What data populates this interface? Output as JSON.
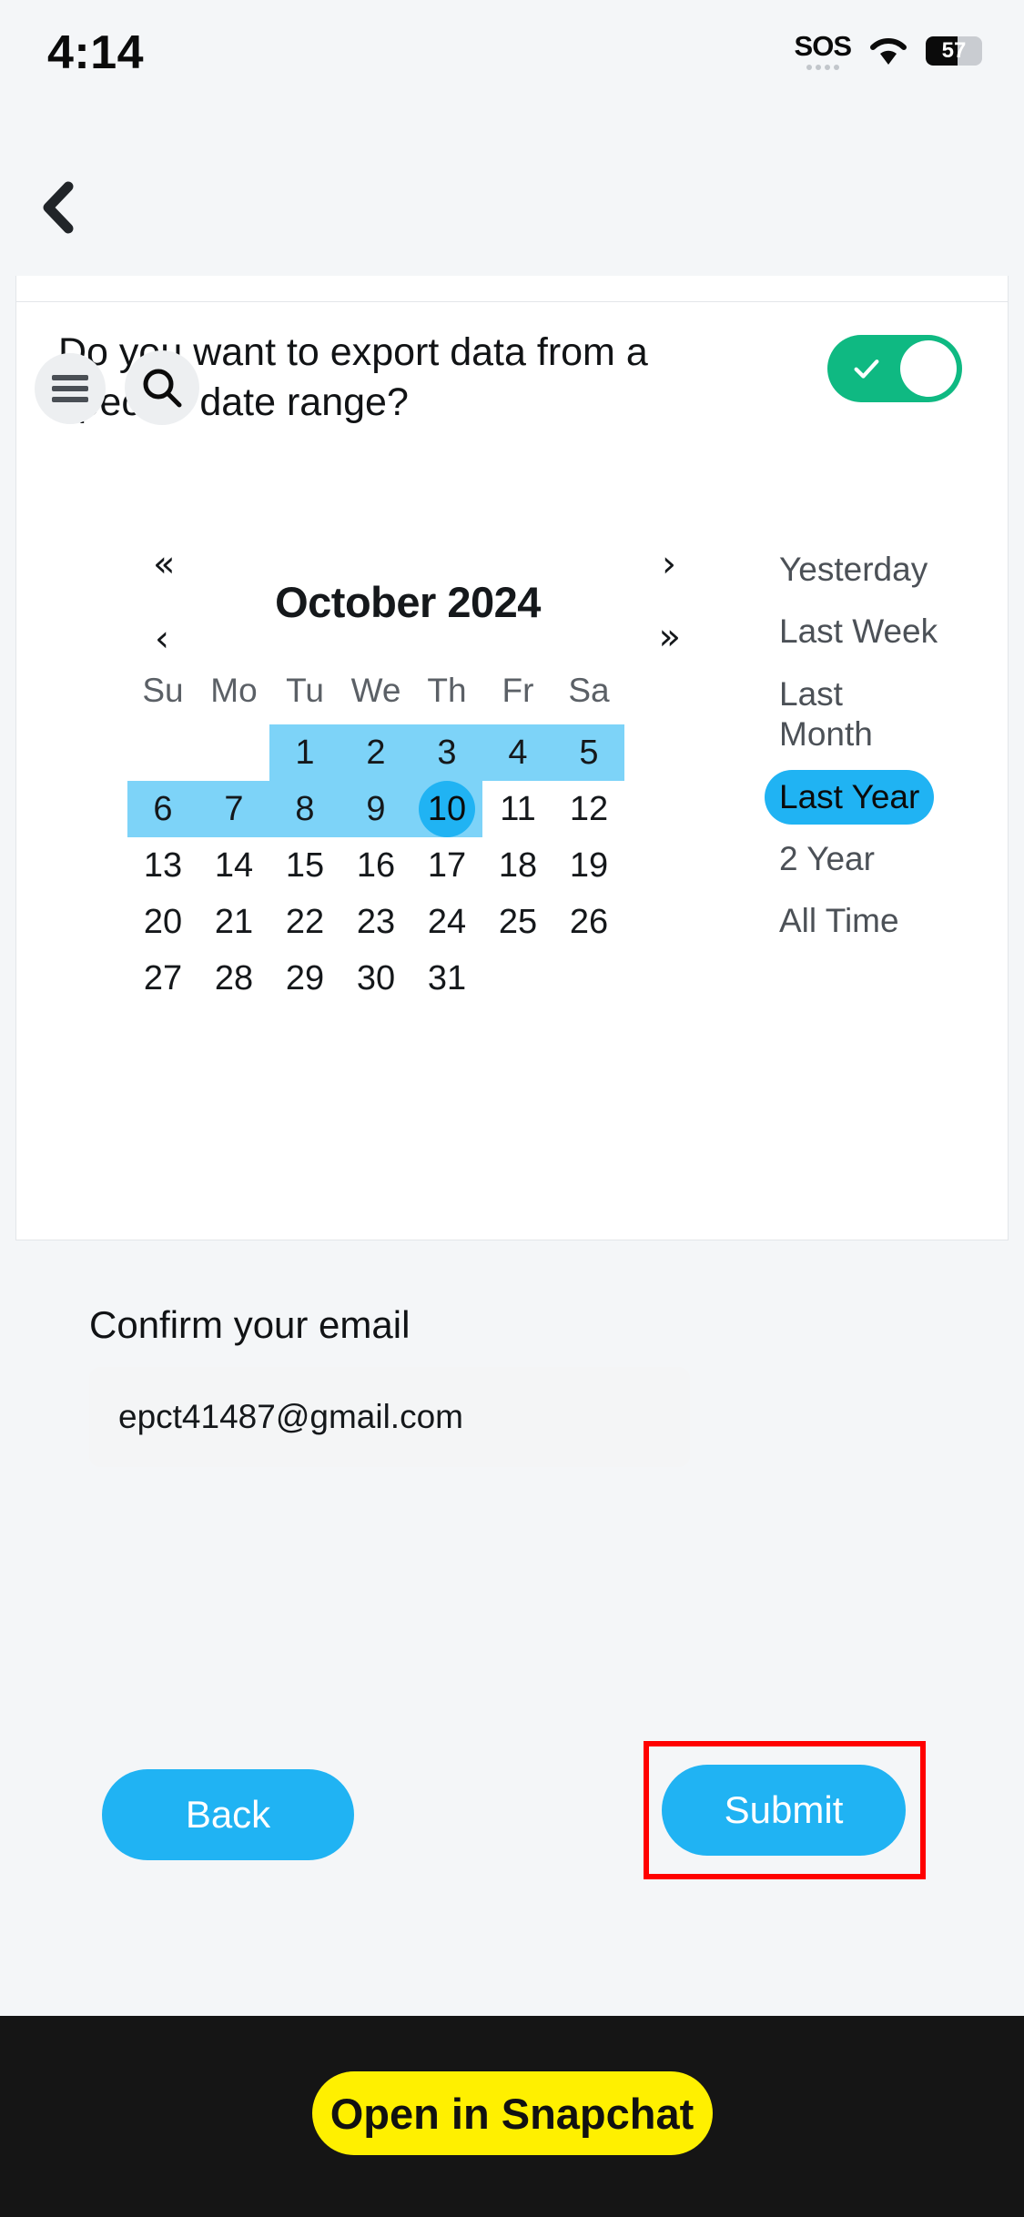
{
  "status_bar": {
    "time": "4:14",
    "sos_label": "SOS",
    "wifi_icon": "wifi-icon",
    "battery_percent": "57",
    "battery_level": 57
  },
  "nav": {
    "back_icon": "chevron-left-icon"
  },
  "overlay_buttons": {
    "menu_icon": "hamburger-menu-icon",
    "search_icon": "search-icon"
  },
  "form": {
    "question": "Do you want to export data from a specific date range?",
    "toggle_state": "on",
    "toggle_icon": "check-icon",
    "email_label": "Confirm your email",
    "email_value": "epct41487@gmail.com"
  },
  "calendar": {
    "title": "October 2024",
    "month": "October",
    "year": "2024",
    "nav": {
      "prev_year": "«",
      "prev_month": "‹",
      "next_month": "›",
      "next_year": "»"
    },
    "weekdays": [
      "Su",
      "Mo",
      "Tu",
      "We",
      "Th",
      "Fr",
      "Sa"
    ],
    "weeks": [
      [
        "",
        "",
        "1",
        "2",
        "3",
        "4",
        "5"
      ],
      [
        "6",
        "7",
        "8",
        "9",
        "10",
        "11",
        "12"
      ],
      [
        "13",
        "14",
        "15",
        "16",
        "17",
        "18",
        "19"
      ],
      [
        "20",
        "21",
        "22",
        "23",
        "24",
        "25",
        "26"
      ],
      [
        "27",
        "28",
        "29",
        "30",
        "31",
        "",
        ""
      ]
    ],
    "range_days": [
      1,
      2,
      3,
      4,
      5,
      6,
      7,
      8,
      9,
      10
    ],
    "selected_day": "10",
    "range_color": "#7dd3f8",
    "selected_color": "#20b3f3"
  },
  "presets": {
    "items": [
      {
        "label": "Yesterday",
        "active": false
      },
      {
        "label": "Last Week",
        "active": false
      },
      {
        "label": "Last Month",
        "active": false
      },
      {
        "label": "Last Year",
        "active": true
      },
      {
        "label": "2 Year",
        "active": false
      },
      {
        "label": "All Time",
        "active": false
      }
    ]
  },
  "actions": {
    "back_label": "Back",
    "submit_label": "Submit",
    "highlight_color": "#ff0000"
  },
  "bottom_bar": {
    "snapchat_label": "Open in Snapchat",
    "accent_color": "#fff000"
  }
}
